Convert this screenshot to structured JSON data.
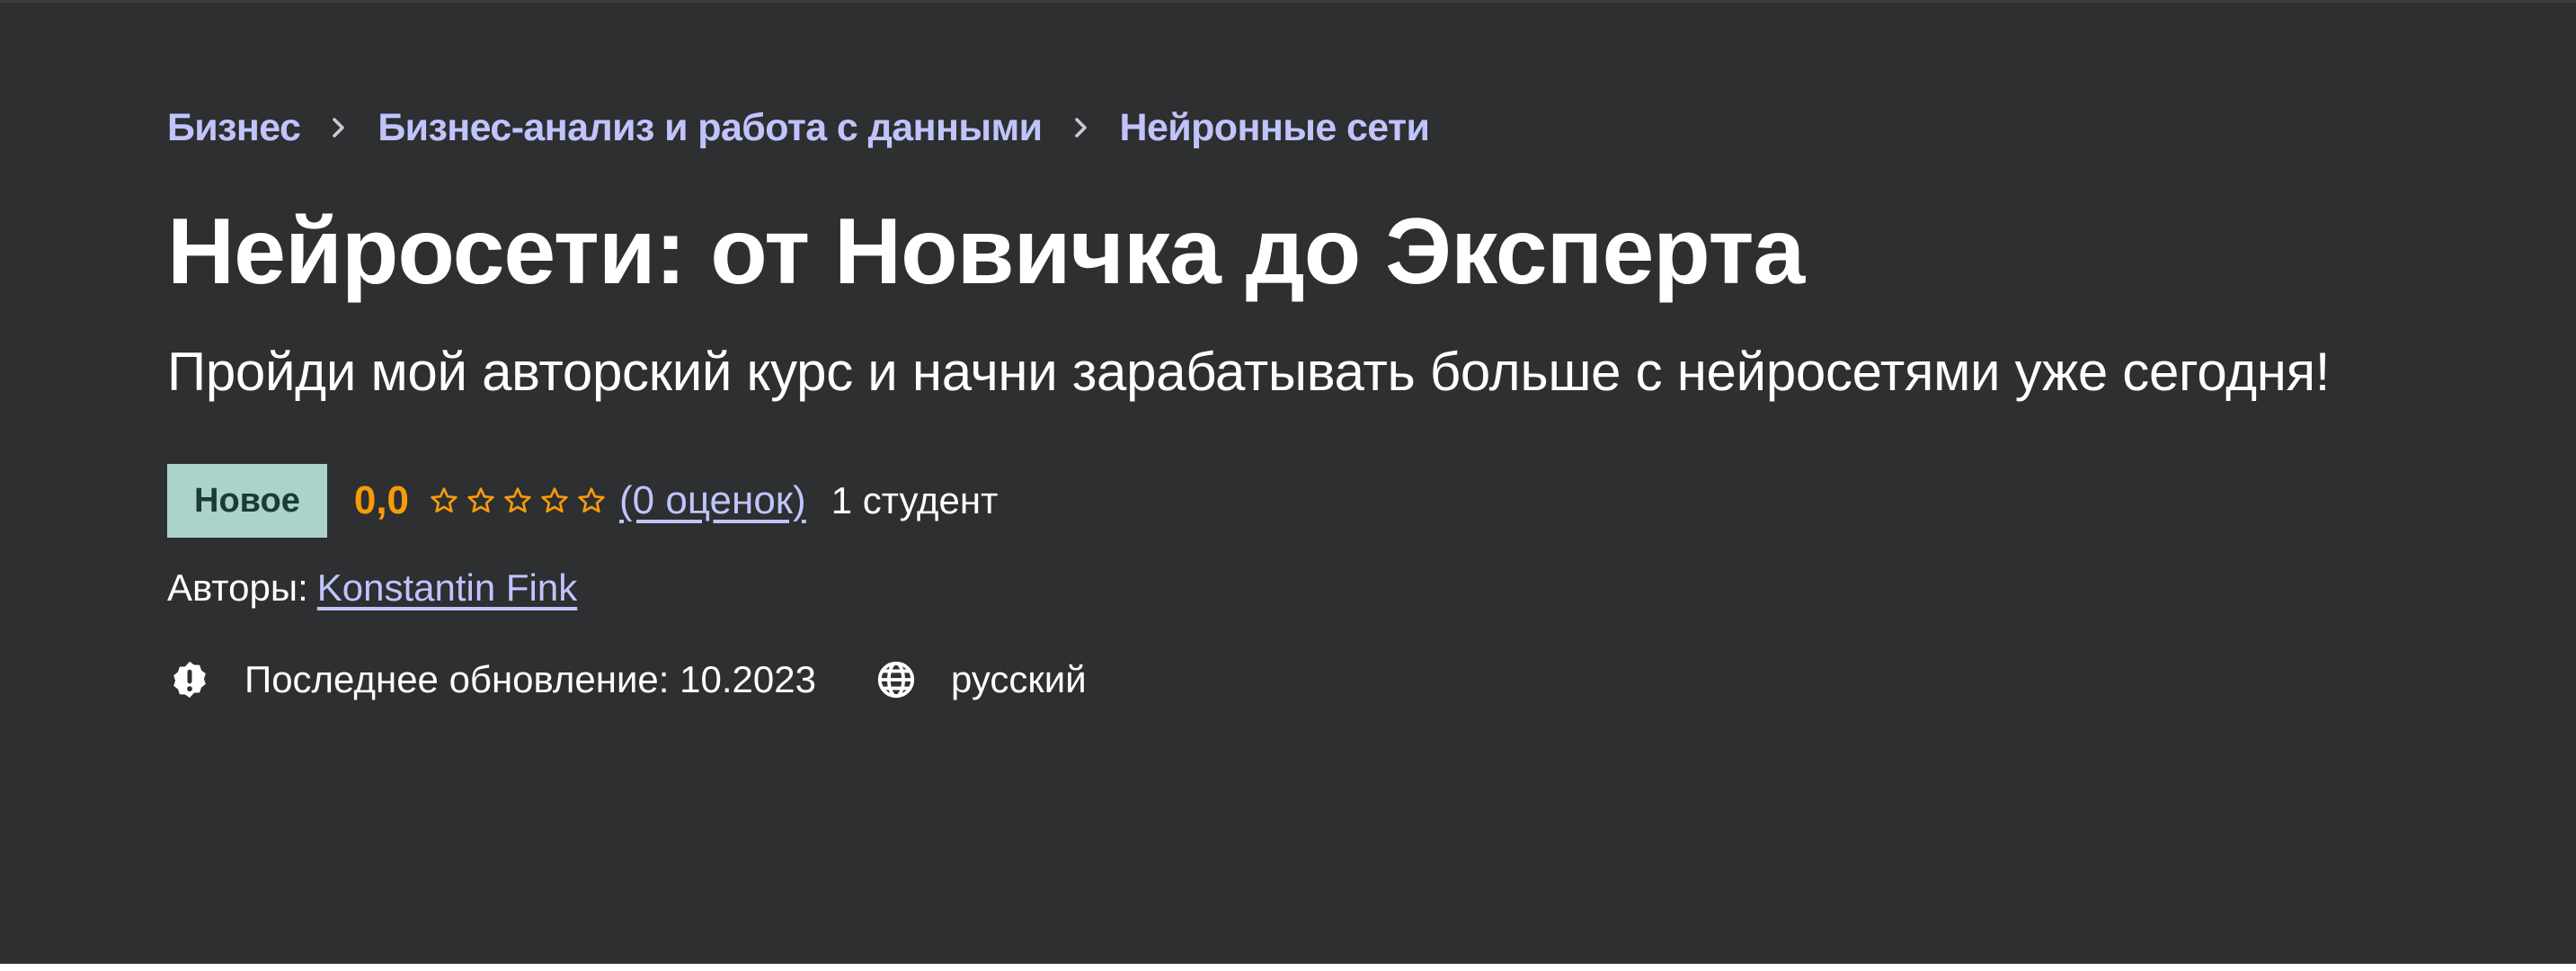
{
  "breadcrumb": {
    "items": [
      {
        "label": "Бизнес"
      },
      {
        "label": "Бизнес-анализ и работа с данными"
      },
      {
        "label": "Нейронные сети"
      }
    ]
  },
  "course": {
    "title": "Нейросети: от Новичка до Эксперта",
    "subtitle": "Пройди мой авторский курс и начни зарабатывать больше с нейросетями уже сегодня!",
    "badge": "Новое",
    "rating": "0,0",
    "stars_filled": 0,
    "stars_total": 5,
    "ratings_count_label": "(0 оценок)",
    "students_label": "1 студент",
    "authors_label": "Авторы:",
    "author_name": "Konstantin Fink",
    "last_updated_label": "Последнее обновление: 10.2023",
    "language": "русский"
  },
  "icons": {
    "breadcrumb_separator": "chevron-right-icon",
    "star": "star-outline-icon",
    "update": "alert-badge-icon",
    "language": "globe-icon"
  },
  "colors": {
    "background": "#2d2f31",
    "link": "#c0c4fc",
    "rating": "#f69c08",
    "badge_bg": "#acd2cc",
    "badge_text": "#1b3b36",
    "text": "#ffffff"
  }
}
